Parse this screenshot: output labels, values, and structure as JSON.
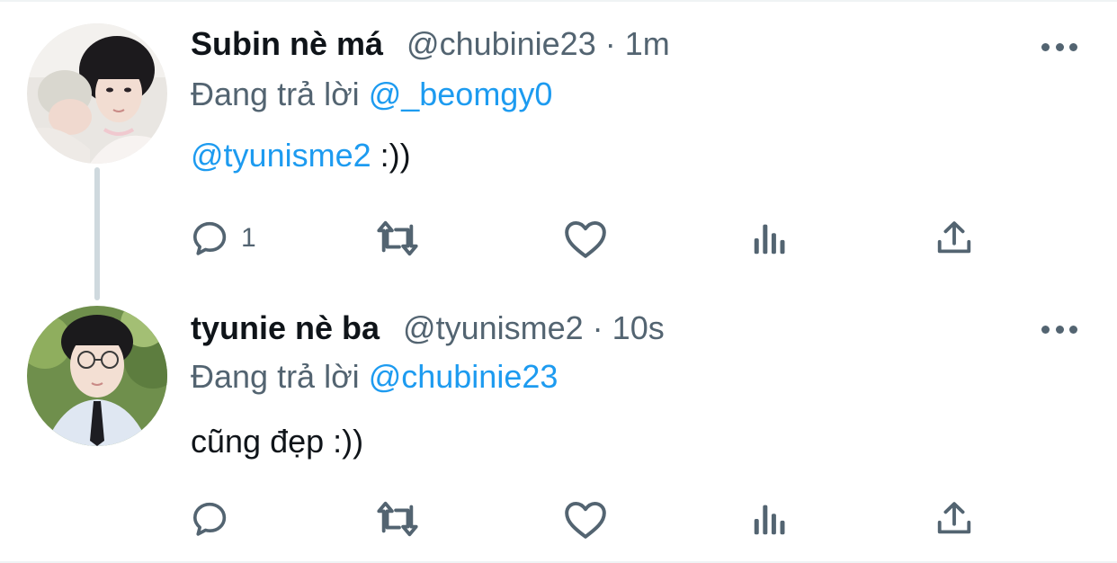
{
  "tweets": [
    {
      "display_name": "Subin nè má",
      "handle": "@chubinie23",
      "separator": "·",
      "time": "1m",
      "reply_prefix": "Đang trả lời ",
      "reply_to": "@_beomgy0",
      "text_mention": "@tyunisme2",
      "text_body": " :))",
      "reply_count": "1",
      "avatar_icon": "profile-photo"
    },
    {
      "display_name": "tyunie nè ba",
      "handle": "@tyunisme2",
      "separator": "·",
      "time": "10s",
      "reply_prefix": "Đang trả lời ",
      "reply_to": "@chubinie23",
      "text_mention": "",
      "text_body": "cũng đẹp :))",
      "reply_count": "",
      "avatar_icon": "profile-photo"
    }
  ],
  "icons": {
    "more": "more-horizontal-icon",
    "reply": "reply-icon",
    "retweet": "retweet-icon",
    "like": "heart-icon",
    "views": "views-icon",
    "share": "share-icon"
  },
  "colors": {
    "text": "#0f1419",
    "secondary": "#536471",
    "accent": "#1d9bf0",
    "thread_line": "#cfd9de"
  }
}
